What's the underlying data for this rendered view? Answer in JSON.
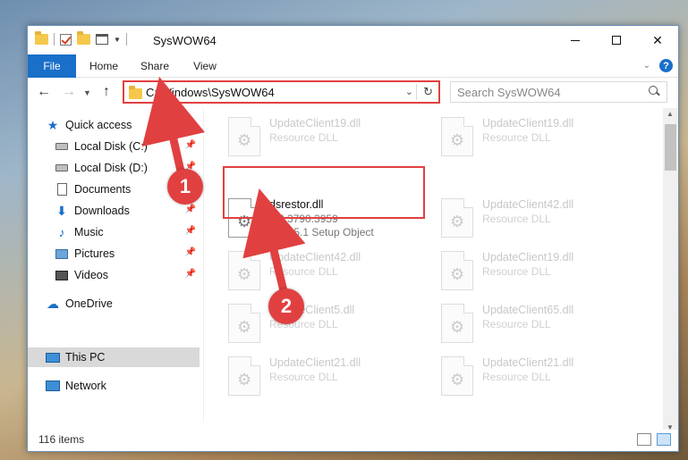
{
  "window": {
    "title": "SysWOW64"
  },
  "ribbon": {
    "tabs": [
      "File",
      "Home",
      "Share",
      "View"
    ]
  },
  "nav": {
    "address": "C:\\Windows\\SysWOW64",
    "search_placeholder": "Search SysWOW64"
  },
  "sidebar": {
    "items": [
      {
        "label": "Quick access",
        "icon": "star-icon",
        "pinned": false
      },
      {
        "label": "Local Disk (C:)",
        "icon": "drive-icon",
        "pinned": true
      },
      {
        "label": "Local Disk (D:)",
        "icon": "drive-icon",
        "pinned": true
      },
      {
        "label": "Documents",
        "icon": "documents-icon",
        "pinned": true
      },
      {
        "label": "Downloads",
        "icon": "downloads-icon",
        "pinned": true
      },
      {
        "label": "Music",
        "icon": "music-icon",
        "pinned": true
      },
      {
        "label": "Pictures",
        "icon": "pictures-icon",
        "pinned": true
      },
      {
        "label": "Videos",
        "icon": "videos-icon",
        "pinned": true
      },
      {
        "label": "OneDrive",
        "icon": "onedrive-icon",
        "pinned": false
      },
      {
        "label": "This PC",
        "icon": "this-pc-icon",
        "pinned": false,
        "selected": true
      },
      {
        "label": "Network",
        "icon": "network-icon",
        "pinned": false
      }
    ]
  },
  "files": [
    {
      "name": "UpdateClient19.dll",
      "line2": "Resource DLL",
      "line3": ""
    },
    {
      "name": "UpdateClient19.dll",
      "line2": "Resource DLL",
      "line3": ""
    },
    {
      "name": "dsrestor.dll",
      "line2": "5.2.3790.3959",
      "line3": "SBS 5.1 Setup Object"
    },
    {
      "name": "UpdateClient42.dll",
      "line2": "Resource DLL",
      "line3": ""
    },
    {
      "name": "UpdateClient42.dll",
      "line2": "Resource DLL",
      "line3": ""
    },
    {
      "name": "UpdateClient19.dll",
      "line2": "Resource DLL",
      "line3": ""
    },
    {
      "name": "UpdateClient5.dll",
      "line2": "Resource DLL",
      "line3": ""
    },
    {
      "name": "UpdateClient65.dll",
      "line2": "Resource DLL",
      "line3": ""
    },
    {
      "name": "UpdateClient21.dll",
      "line2": "Resource DLL",
      "line3": ""
    },
    {
      "name": "UpdateClient21.dll",
      "line2": "Resource DLL",
      "line3": ""
    }
  ],
  "status": {
    "item_count": "116 items"
  },
  "annotations": {
    "step1": "1",
    "step2": "2",
    "color": "#e14040"
  }
}
